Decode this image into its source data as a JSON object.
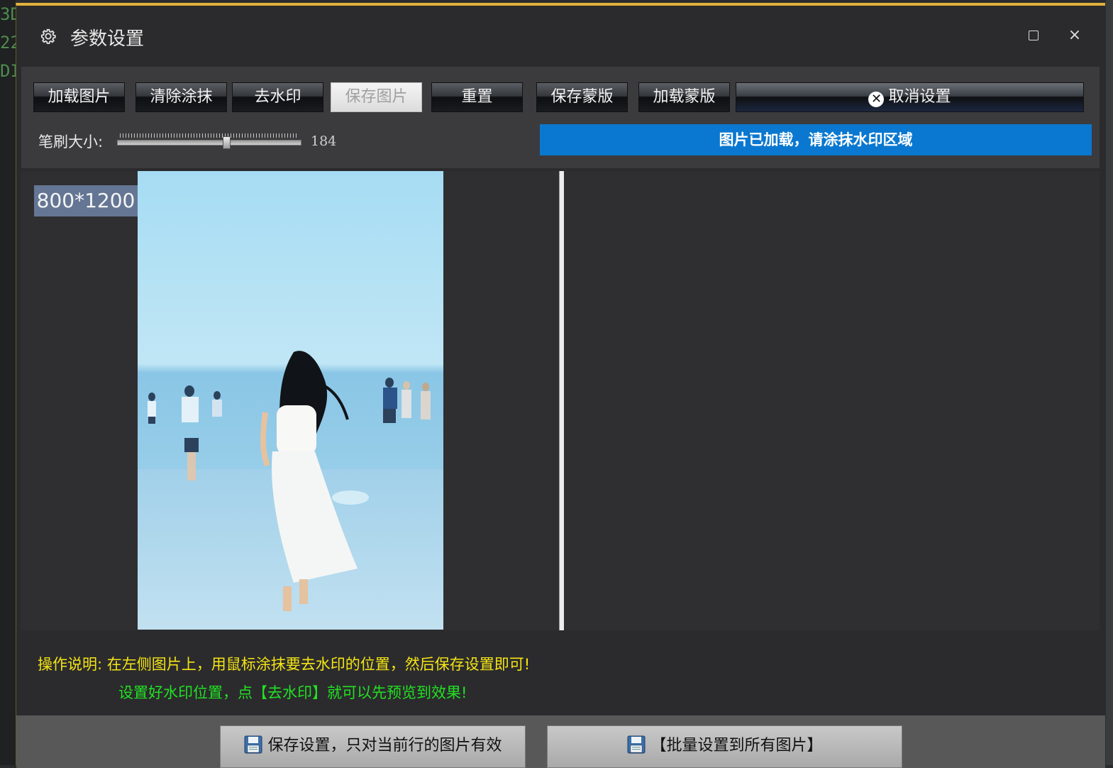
{
  "background": {
    "left_chars": [
      "3D",
      "22",
      "DI"
    ]
  },
  "dialog": {
    "title": "参数设置",
    "icons": {
      "settings": "gear-icon",
      "maximize": "maximize-icon",
      "close": "close-icon"
    },
    "close_glyph": "×"
  },
  "toolbar": {
    "buttons": [
      {
        "label": "加载图片",
        "enabled": true
      },
      {
        "label": "清除涂抹",
        "enabled": true
      },
      {
        "label": "去水印",
        "enabled": true
      },
      {
        "label": "保存图片",
        "enabled": false
      },
      {
        "label": "重置",
        "enabled": true
      },
      {
        "label": "保存蒙版",
        "enabled": true
      },
      {
        "label": "加载蒙版",
        "enabled": true
      },
      {
        "label": "取消设置",
        "enabled": true
      }
    ],
    "brush": {
      "label": "笔刷大小:",
      "value": "184",
      "fraction": 0.6
    },
    "status": "图片已加载，请涂抹水印区域",
    "status_color": "#0a78d0"
  },
  "preview": {
    "image_size": "800*1200"
  },
  "instructions": {
    "label": "操作说明:",
    "line1": "在左侧图片上，用鼠标涂抹要去水印的位置，然后保存设置即可!",
    "line2": "设置好水印位置，点【去水印】就可以先预览到效果!"
  },
  "bottom": {
    "save_current": "保存设置，只对当前行的图片有效",
    "batch_apply": "【批量设置到所有图片】"
  }
}
